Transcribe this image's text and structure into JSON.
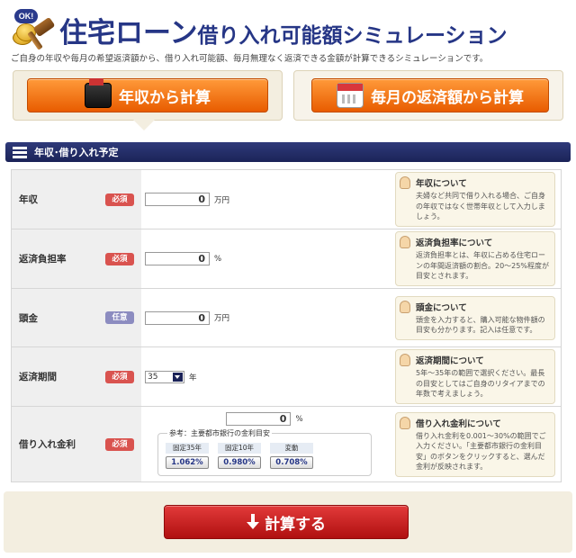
{
  "header": {
    "logo_badge": "OK!",
    "title_main": "住宅ローン",
    "title_sub": "借り入れ可能額シミュレーション",
    "subtitle": "ご自身の年収や毎月の希望返済額から、借り入れ可能額、毎月無理なく返済できる金額が計算できるシミュレーションです。"
  },
  "modes": {
    "income_label": "年収から計算",
    "monthly_label": "毎月の返済額から計算"
  },
  "section": {
    "title": "年収･借り入れ予定"
  },
  "rows": [
    {
      "label": "年収",
      "badge": "必須",
      "value": "0",
      "unit": "万円",
      "help_title": "年収について",
      "help_text": "夫婦など共同で借り入れる場合、ご自身の年収ではなく世帯年収として入力しましょう。"
    },
    {
      "label": "返済負担率",
      "badge": "必須",
      "value": "0",
      "unit": "%",
      "help_title": "返済負担率について",
      "help_text": "返済負担率とは、年収に占める住宅ローンの年間返済額の割合。20～25%程度が目安とされます。"
    },
    {
      "label": "頭金",
      "badge": "任意",
      "value": "0",
      "unit": "万円",
      "help_title": "頭金について",
      "help_text": "頭金を入力すると、購入可能な物件額の目安も分かります。記入は任意です。"
    },
    {
      "label": "返済期間",
      "badge": "必須",
      "value": "35",
      "unit": "年",
      "help_title": "返済期間について",
      "help_text": "5年～35年の範囲で選択ください。最長の目安としてはご自身のリタイアまでの年数で考えましょう。"
    },
    {
      "label": "借り入れ金利",
      "badge": "必須",
      "value": "0",
      "unit": "%",
      "help_title": "借り入れ金利について",
      "help_text": "借り入れ金利を0.001～30%の範囲でご入力ください。「主要都市銀行の金利目安」のボタンをクリックすると、選んだ金利が反映されます。"
    }
  ],
  "rate_reference": {
    "title": "参考：主要都市銀行の金利目安",
    "items": [
      {
        "label": "固定35年",
        "value": "1.062%"
      },
      {
        "label": "固定10年",
        "value": "0.980%"
      },
      {
        "label": "変動",
        "value": "0.708%"
      }
    ]
  },
  "calculate": {
    "label": "計算する"
  },
  "colors": {
    "navy": "#263686",
    "orange": "#e85c00",
    "red": "#b01010",
    "required_badge": "#d9534f",
    "optional_badge": "#8c8cc0"
  }
}
